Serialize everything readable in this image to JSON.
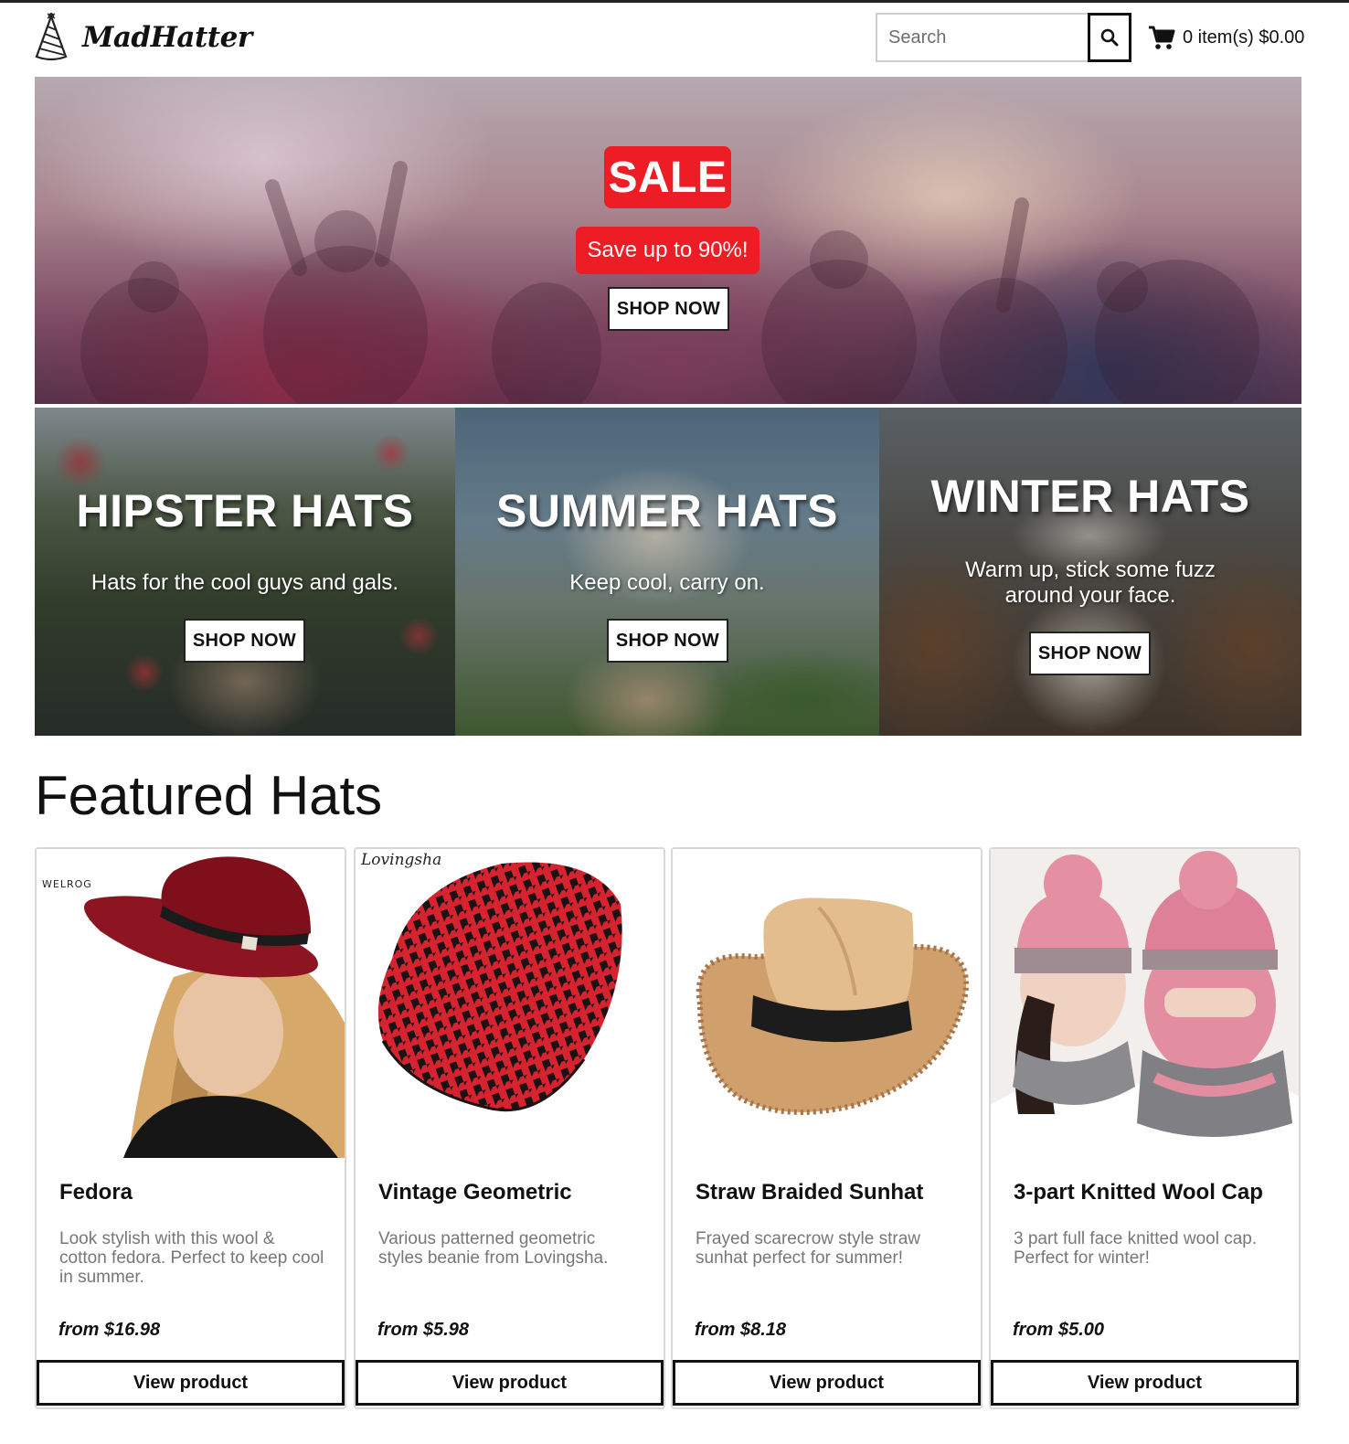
{
  "header": {
    "brand": "MadHatter",
    "search_placeholder": "Search",
    "cart_text": "0 item(s) $0.00"
  },
  "hero": {
    "badge": "SALE",
    "subtitle": "Save up to 90%!",
    "cta": "SHOP NOW"
  },
  "categories": [
    {
      "title": "HIPSTER HATS",
      "description": "Hats for the cool guys and gals.",
      "cta": "SHOP NOW"
    },
    {
      "title": "SUMMER HATS",
      "description": "Keep cool, carry on.",
      "cta": "SHOP NOW"
    },
    {
      "title": "WINTER HATS",
      "description_line1": "Warm up, stick some fuzz",
      "description_line2": "around your face.",
      "cta": "SHOP NOW"
    }
  ],
  "featured": {
    "title": "Featured Hats",
    "products": [
      {
        "name": "Fedora",
        "description": "Look stylish with this wool & cotton fedora. Perfect to keep cool in summer.",
        "price": "from $16.98",
        "cta": "View product",
        "brand_mark": "WELROG"
      },
      {
        "name": "Vintage Geometric",
        "description": "Various patterned geometric styles beanie from Lovingsha.",
        "price": "from $5.98",
        "cta": "View product",
        "brand_mark": "Lovingsha"
      },
      {
        "name": "Straw Braided Sunhat",
        "description": "Frayed scarecrow style straw sunhat perfect for summer!",
        "price": "from $8.18",
        "cta": "View product"
      },
      {
        "name": "3-part Knitted Wool Cap",
        "description": "3 part full face knitted wool cap. Perfect for winter!",
        "price": "from $5.00",
        "cta": "View product"
      }
    ]
  },
  "colors": {
    "accent_red": "#ee1c25",
    "text_dark": "#111111",
    "text_muted": "#777777",
    "card_border": "#d8d8d8"
  },
  "icons": {
    "logo": "party-hat-icon",
    "search": "search-icon",
    "cart": "cart-icon"
  }
}
